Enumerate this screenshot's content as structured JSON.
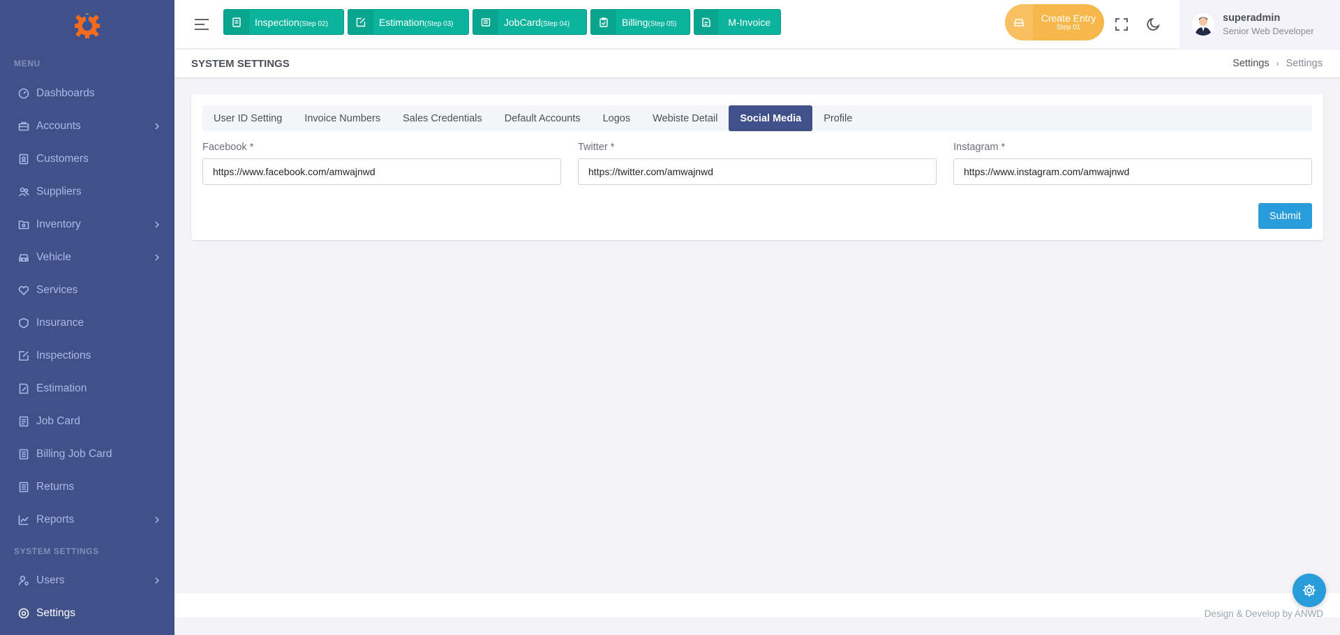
{
  "sidebar": {
    "menu_title": "MENU",
    "system_title": "SYSTEM SETTINGS",
    "items": [
      {
        "label": "Dashboards",
        "icon": "dashboard-icon",
        "has_children": false
      },
      {
        "label": "Accounts",
        "icon": "briefcase-icon",
        "has_children": true
      },
      {
        "label": "Customers",
        "icon": "file-user-icon",
        "has_children": false
      },
      {
        "label": "Suppliers",
        "icon": "group-icon",
        "has_children": false
      },
      {
        "label": "Inventory",
        "icon": "folder-icon",
        "has_children": true
      },
      {
        "label": "Vehicle",
        "icon": "car-icon",
        "has_children": true
      },
      {
        "label": "Services",
        "icon": "hand-heart-icon",
        "has_children": false
      },
      {
        "label": "Insurance",
        "icon": "shield-icon",
        "has_children": false
      },
      {
        "label": "Inspections",
        "icon": "edit-box-icon",
        "has_children": false
      },
      {
        "label": "Estimation",
        "icon": "file-edit-icon",
        "has_children": false
      },
      {
        "label": "Job Card",
        "icon": "file-text-icon",
        "has_children": false
      },
      {
        "label": "Billing Job Card",
        "icon": "file-list-icon",
        "has_children": false
      },
      {
        "label": "Returns",
        "icon": "file-list-icon",
        "has_children": false
      },
      {
        "label": "Reports",
        "icon": "line-chart-icon",
        "has_children": true
      }
    ],
    "system_items": [
      {
        "label": "Users",
        "icon": "user-settings-icon",
        "has_children": true
      },
      {
        "label": "Settings",
        "icon": "settings-icon",
        "has_children": false,
        "active": true
      }
    ]
  },
  "topbar": {
    "steps": [
      {
        "label": "Inspection",
        "step": "(Step 02)",
        "icon": "file-icon"
      },
      {
        "label": "Estimation",
        "step": "(Step 03)",
        "icon": "edit-icon"
      },
      {
        "label": "JobCard",
        "step": "(Step 04)",
        "icon": "card-icon"
      },
      {
        "label": "Billing",
        "step": "(Step 05)",
        "icon": "clipboard-icon"
      },
      {
        "label": "M-Invoice",
        "step": "",
        "icon": "invoice-icon"
      }
    ],
    "create_entry": {
      "label": "Create Entry",
      "step": "Step 01"
    },
    "user": {
      "name": "superadmin",
      "role": "Senior Web Developer"
    }
  },
  "page": {
    "title": "SYSTEM SETTINGS",
    "breadcrumb": [
      "Settings",
      "Settings"
    ]
  },
  "settings": {
    "tabs": [
      "User ID Setting",
      "Invoice Numbers",
      "Sales Credentials",
      "Default Accounts",
      "Logos",
      "Webiste Detail",
      "Social Media",
      "Profile"
    ],
    "active_tab": "Social Media",
    "fields": [
      {
        "label": "Facebook *",
        "value": "https://www.facebook.com/amwajnwd"
      },
      {
        "label": "Twitter *",
        "value": "https://twitter.com/amwajnwd"
      },
      {
        "label": "Instagram *",
        "value": "https://www.instagram.com/amwajnwd"
      }
    ],
    "submit_label": "Submit"
  },
  "footer": {
    "text": "Design & Develop by ANWD"
  },
  "colors": {
    "sidebar_bg": "#405189",
    "step_green": "#0ab39c",
    "create_orange": "#f7b84b",
    "submit_blue": "#299cdb",
    "tab_active": "#405189"
  }
}
